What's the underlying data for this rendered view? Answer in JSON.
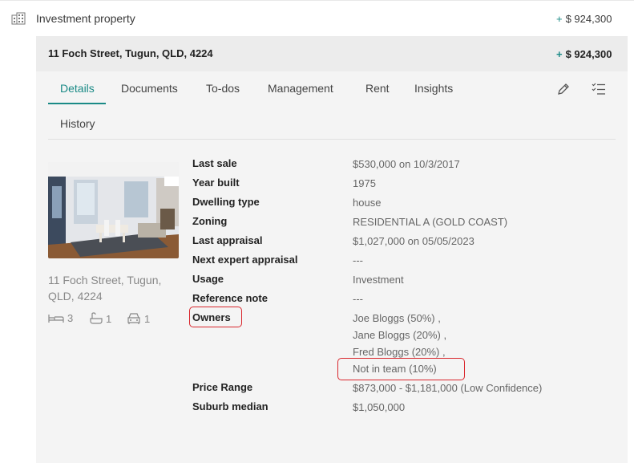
{
  "header": {
    "title": "Investment property",
    "amount_sign": "+",
    "amount": "$ 924,300"
  },
  "property": {
    "address": "11 Foch Street, Tugun, QLD, 4224",
    "amount_sign": "+",
    "amount": "$ 924,300"
  },
  "tabs": [
    {
      "label": "Details",
      "active": true
    },
    {
      "label": "Documents"
    },
    {
      "label": "To-dos"
    },
    {
      "label": "Management"
    },
    {
      "label": "Rent"
    },
    {
      "label": "Insights"
    },
    {
      "label": "History"
    }
  ],
  "tab_actions": [
    "pencil-icon",
    "checklist-icon"
  ],
  "card": {
    "address": "11 Foch Street, Tugun, QLD, 4224",
    "bedrooms": "3",
    "bathrooms": "1",
    "parking": "1"
  },
  "details": [
    {
      "label": "Last sale",
      "value": "$530,000 on 10/3/2017"
    },
    {
      "label": "Year built",
      "value": "1975"
    },
    {
      "label": "Dwelling type",
      "value": "house"
    },
    {
      "label": "Zoning",
      "value": "RESIDENTIAL A (GOLD COAST)"
    },
    {
      "label": "Last appraisal",
      "value": "$1,027,000 on 05/05/2023"
    },
    {
      "label": "Next expert appraisal",
      "value": "---"
    },
    {
      "label": "Usage",
      "value": "Investment"
    },
    {
      "label": "Reference note",
      "value": "---"
    },
    {
      "label": "Owners",
      "values": [
        "Joe Bloggs (50%) ,",
        "Jane Bloggs (20%) ,",
        "Fred Bloggs (20%) ,",
        "Not in team (10%)"
      ]
    },
    {
      "label": "Price Range",
      "value": "$873,000 - $1,181,000 (Low Confidence)"
    },
    {
      "label": "Suburb median",
      "value": "$1,050,000"
    }
  ],
  "colors": {
    "accent": "#1a8a86",
    "highlight": "#d9262c"
  }
}
